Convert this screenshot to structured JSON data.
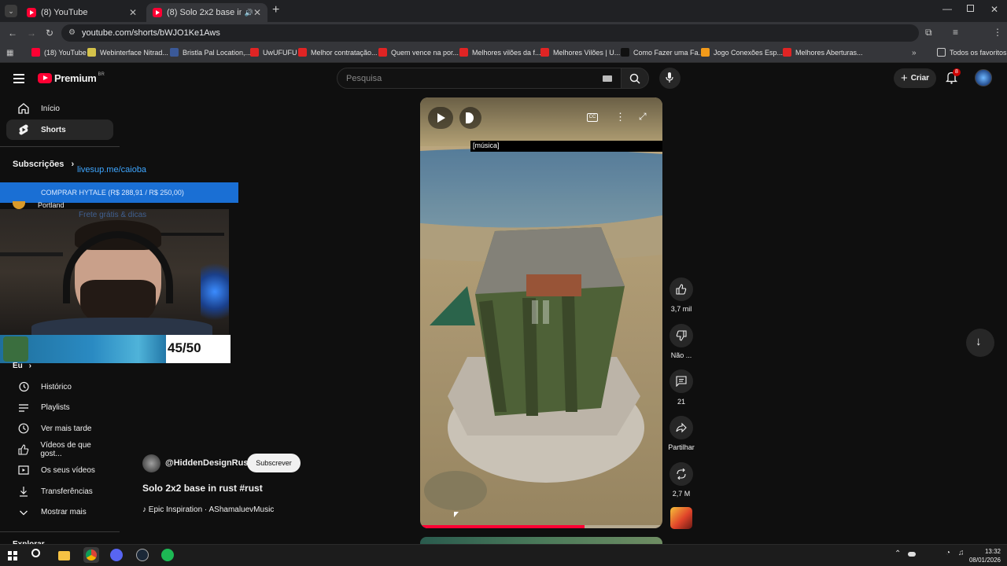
{
  "browser": {
    "tabs": [
      {
        "title": "(8) YouTube",
        "active": false
      },
      {
        "title": "(8) Solo 2x2 base in rust #r...",
        "active": true
      }
    ],
    "url": "youtube.com/shorts/bWJO1Ke1Aws",
    "bookmarks": [
      {
        "label": "(18) YouTube",
        "color": "#ff0033"
      },
      {
        "label": "Webinterface Nitrad...",
        "color": "#d4c24a"
      },
      {
        "label": "Bristla Pal Location,...",
        "color": "#3b5998"
      },
      {
        "label": "UwUFUFU",
        "color": "#e02424"
      },
      {
        "label": "Melhor contratação...",
        "color": "#e02424"
      },
      {
        "label": "Quem vence na por...",
        "color": "#e02424"
      },
      {
        "label": "Melhores vilões da f...",
        "color": "#e02424"
      },
      {
        "label": "Melhores Vilões | U...",
        "color": "#e02424"
      },
      {
        "label": "Como Fazer uma Fa...",
        "color": "#111111"
      },
      {
        "label": "Jogo Conexões Esp...",
        "color": "#f29a1a"
      },
      {
        "label": "Melhores Aberturas...",
        "color": "#e02424"
      }
    ],
    "all_bookmarks": "Todos os favoritos"
  },
  "header": {
    "logo": "Premium",
    "country": "BR",
    "search_placeholder": "Pesquisa",
    "create_label": "Criar",
    "notifications": "8"
  },
  "sidebar": {
    "items": [
      {
        "label": "Início",
        "icon": "home-icon"
      },
      {
        "label": "Shorts",
        "icon": "shorts-icon",
        "active": true
      }
    ],
    "subscriptions_title": "Subscrições",
    "sub_items": [
      {
        "label": "Portland"
      }
    ],
    "you_title": "Eu",
    "you_items": [
      {
        "label": "Histórico",
        "icon": "history-icon"
      },
      {
        "label": "Playlists",
        "icon": "playlist-icon"
      },
      {
        "label": "Ver mais tarde",
        "icon": "clock-icon"
      },
      {
        "label": "Vídeos de que gost...",
        "icon": "like-icon"
      },
      {
        "label": "Os seus vídeos",
        "icon": "video-icon"
      },
      {
        "label": "Transferências",
        "icon": "download-icon"
      },
      {
        "label": "Mostrar mais",
        "icon": "chevron-down-icon"
      }
    ],
    "explore_title": "Explorar"
  },
  "overlay": {
    "link_text": "livesup.me/caioba",
    "banner_text": "COMPRAR HYTALE (R$ 288,91 / R$ 250,00)",
    "faded_text": "Frete grátis & dicas",
    "goal_count": "45/50"
  },
  "short": {
    "channel": "@HiddenDesignRust",
    "subscribe": "Subscrever",
    "title": "Solo 2x2 base in rust #rust",
    "music": "Epic Inspiration · AShamaluevMusic",
    "caption": "[música]",
    "progress": 0.68
  },
  "actions": {
    "likes": "3,7 mil",
    "dislike": "Não ...",
    "comments": "21",
    "share": "Partilhar",
    "remix": "2,7 M"
  },
  "taskbar": {
    "time": "13:32",
    "date": "08/01/2026"
  },
  "colors": {
    "accent_red": "#ff0033",
    "banner_blue": "#1a6fd4",
    "link_blue": "#3ea6ff"
  }
}
